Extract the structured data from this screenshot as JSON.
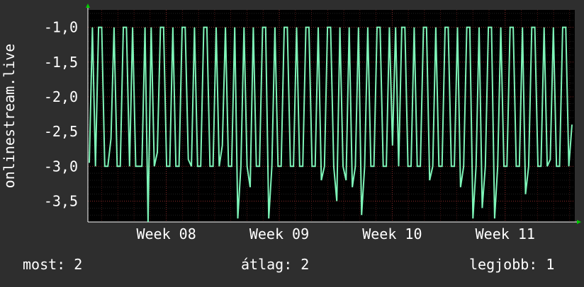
{
  "chart_data": {
    "type": "line",
    "ylabel": "onlinestream.live",
    "xlabel": "",
    "title": "",
    "ylim": [
      -3.8,
      -0.75
    ],
    "yticks": [
      -1.0,
      -1.5,
      -2.0,
      -2.5,
      -3.0,
      -3.5
    ],
    "ytick_labels": [
      "-1,0",
      "-1,5",
      "-2,0",
      "-2,5",
      "-3,0",
      "-3,5"
    ],
    "xlim": [
      0,
      100
    ],
    "xticks": [
      {
        "label": "Week 08",
        "x": 16.1
      },
      {
        "label": "Week 09",
        "x": 39.3
      },
      {
        "label": "Week 10",
        "x": 62.5
      },
      {
        "label": "Week 11",
        "x": 85.7
      }
    ],
    "grid": true,
    "colors": {
      "background": "#2e2e2e",
      "plot_background": "#000000",
      "line": "#7ef5b8",
      "grid_major": "#4a4a4a",
      "grid_minor": "#6a2020",
      "axis_arrow": "#00cc00"
    },
    "series": [
      {
        "values": [
          -2.95,
          -1.0,
          -3.0,
          -1.0,
          -1.0,
          -3.0,
          -3.0,
          -2.6,
          -1.0,
          -3.0,
          -3.0,
          -1.0,
          -1.0,
          -3.0,
          -1.0,
          -3.0,
          -3.0,
          -3.0,
          -1.0,
          -3.8,
          -1.0,
          -3.0,
          -2.8,
          -1.0,
          -1.0,
          -3.0,
          -3.0,
          -1.0,
          -3.0,
          -3.0,
          -1.0,
          -1.0,
          -2.9,
          -3.0,
          -1.0,
          -3.0,
          -3.0,
          -1.0,
          -1.0,
          -3.0,
          -3.0,
          -1.0,
          -3.0,
          -2.7,
          -1.0,
          -3.0,
          -3.0,
          -1.0,
          -3.75,
          -3.0,
          -1.0,
          -3.0,
          -3.3,
          -1.0,
          -3.0,
          -3.0,
          -1.0,
          -1.0,
          -3.75,
          -3.0,
          -1.0,
          -3.0,
          -3.0,
          -1.0,
          -1.0,
          -3.0,
          -3.0,
          -1.0,
          -3.0,
          -3.0,
          -1.0,
          -1.0,
          -3.0,
          -3.0,
          -1.0,
          -3.2,
          -3.0,
          -1.0,
          -1.0,
          -3.0,
          -3.5,
          -1.0,
          -3.0,
          -3.2,
          -1.0,
          -3.3,
          -3.0,
          -1.0,
          -3.7,
          -3.0,
          -1.0,
          -3.0,
          -3.0,
          -1.0,
          -1.0,
          -3.0,
          -3.0,
          -1.0,
          -2.7,
          -1.0,
          -3.0,
          -1.0,
          -1.0,
          -3.0,
          -3.0,
          -1.0,
          -3.0,
          -3.0,
          -1.0,
          -1.0,
          -3.2,
          -3.0,
          -1.0,
          -3.0,
          -3.0,
          -1.0,
          -1.0,
          -3.0,
          -3.0,
          -1.0,
          -3.3,
          -3.0,
          -1.0,
          -1.0,
          -3.75,
          -3.0,
          -1.0,
          -3.6,
          -3.0,
          -1.0,
          -1.0,
          -3.75,
          -3.0,
          -1.0,
          -3.0,
          -3.0,
          -1.0,
          -1.0,
          -3.0,
          -3.0,
          -1.0,
          -3.4,
          -3.0,
          -1.0,
          -1.0,
          -3.0,
          -3.0,
          -1.0,
          -3.0,
          -2.9,
          -1.0,
          -3.0,
          -3.0,
          -1.0,
          -1.0,
          -3.0,
          -2.4
        ]
      }
    ]
  },
  "footer": {
    "current": "most: 2",
    "average": "átlag: 2",
    "best": "legjobb: 1"
  }
}
